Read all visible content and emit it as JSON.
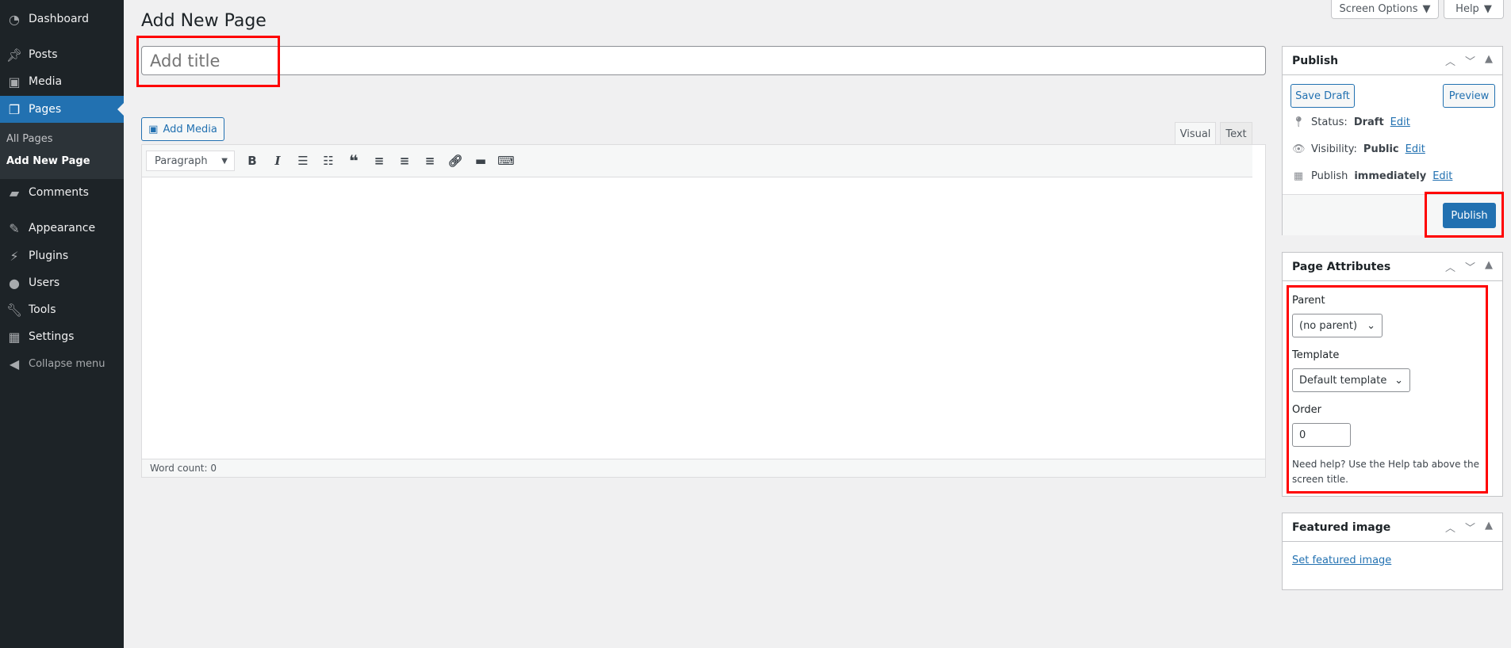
{
  "sidebar": {
    "items": [
      {
        "label": "Dashboard",
        "icon": "dashboard-icon"
      },
      {
        "label": "Posts",
        "icon": "pin-icon"
      },
      {
        "label": "Media",
        "icon": "media-icon"
      },
      {
        "label": "Pages",
        "icon": "pages-icon"
      },
      {
        "label": "Comments",
        "icon": "comment-icon"
      },
      {
        "label": "Appearance",
        "icon": "brush-icon"
      },
      {
        "label": "Plugins",
        "icon": "plugin-icon"
      },
      {
        "label": "Users",
        "icon": "user-icon"
      },
      {
        "label": "Tools",
        "icon": "wrench-icon"
      },
      {
        "label": "Settings",
        "icon": "settings-icon"
      },
      {
        "label": "Collapse menu",
        "icon": "collapse-icon"
      }
    ],
    "submenu": [
      "All Pages",
      "Add New Page"
    ]
  },
  "header": {
    "title": "Add New Page",
    "screen_options": "Screen Options",
    "help": "Help"
  },
  "editor": {
    "title_placeholder": "Add title",
    "add_media": "Add Media",
    "tabs": [
      "Visual",
      "Text"
    ],
    "format": "Paragraph",
    "word_count": "Word count: 0",
    "toolbar": [
      "bold",
      "italic",
      "bulleted-list",
      "numbered-list",
      "blockquote",
      "align-left",
      "align-center",
      "align-right",
      "link",
      "read-more",
      "toolbar-toggle"
    ]
  },
  "publish": {
    "title": "Publish",
    "save_draft": "Save Draft",
    "preview": "Preview",
    "status_label": "Status:",
    "status": "Draft",
    "visibility_label": "Visibility:",
    "visibility": "Public",
    "publish_label": "Publish",
    "publish_when": "immediately",
    "edit": "Edit",
    "publish_button": "Publish"
  },
  "attributes": {
    "title": "Page Attributes",
    "parent_label": "Parent",
    "parent": "(no parent)",
    "template_label": "Template",
    "template": "Default template",
    "order_label": "Order",
    "order": "0",
    "help": "Need help? Use the Help tab above the screen title."
  },
  "featured": {
    "title": "Featured image",
    "link": "Set featured image"
  },
  "colors": {
    "accent": "#2271b1",
    "sidebar": "#1d2327",
    "highlight": "#ff0000"
  }
}
